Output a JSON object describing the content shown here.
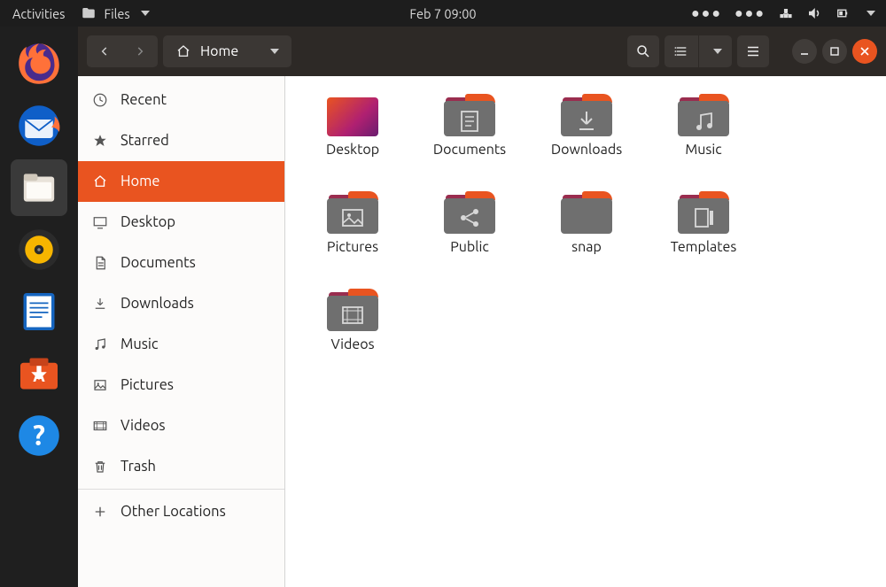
{
  "panel": {
    "activities": "Activities",
    "app_menu": "Files",
    "clock": "Feb 7  09:00"
  },
  "dock": {
    "firefox": "Firefox",
    "thunderbird": "Thunderbird",
    "files": "Files",
    "rhythmbox": "Rhythmbox",
    "writer": "LibreOffice Writer",
    "software": "Ubuntu Software",
    "help": "Help"
  },
  "titlebar": {
    "path_label": "Home"
  },
  "sidebar": {
    "items": [
      {
        "icon": "clock-icon",
        "label": "Recent"
      },
      {
        "icon": "star-icon",
        "label": "Starred"
      },
      {
        "icon": "home-icon",
        "label": "Home"
      },
      {
        "icon": "desktop-icon",
        "label": "Desktop"
      },
      {
        "icon": "document-icon",
        "label": "Documents"
      },
      {
        "icon": "download-icon",
        "label": "Downloads"
      },
      {
        "icon": "music-icon",
        "label": "Music"
      },
      {
        "icon": "image-icon",
        "label": "Pictures"
      },
      {
        "icon": "video-icon",
        "label": "Videos"
      },
      {
        "icon": "trash-icon",
        "label": "Trash"
      }
    ],
    "other": "Other Locations"
  },
  "files": [
    {
      "name": "Desktop",
      "kind": "desktop"
    },
    {
      "name": "Documents",
      "kind": "folder",
      "glyph": "document"
    },
    {
      "name": "Downloads",
      "kind": "folder",
      "glyph": "download"
    },
    {
      "name": "Music",
      "kind": "folder",
      "glyph": "music"
    },
    {
      "name": "Pictures",
      "kind": "folder",
      "glyph": "image"
    },
    {
      "name": "Public",
      "kind": "folder",
      "glyph": "share"
    },
    {
      "name": "snap",
      "kind": "folder",
      "glyph": ""
    },
    {
      "name": "Templates",
      "kind": "folder",
      "glyph": "templates"
    },
    {
      "name": "Videos",
      "kind": "folder",
      "glyph": "video"
    }
  ]
}
